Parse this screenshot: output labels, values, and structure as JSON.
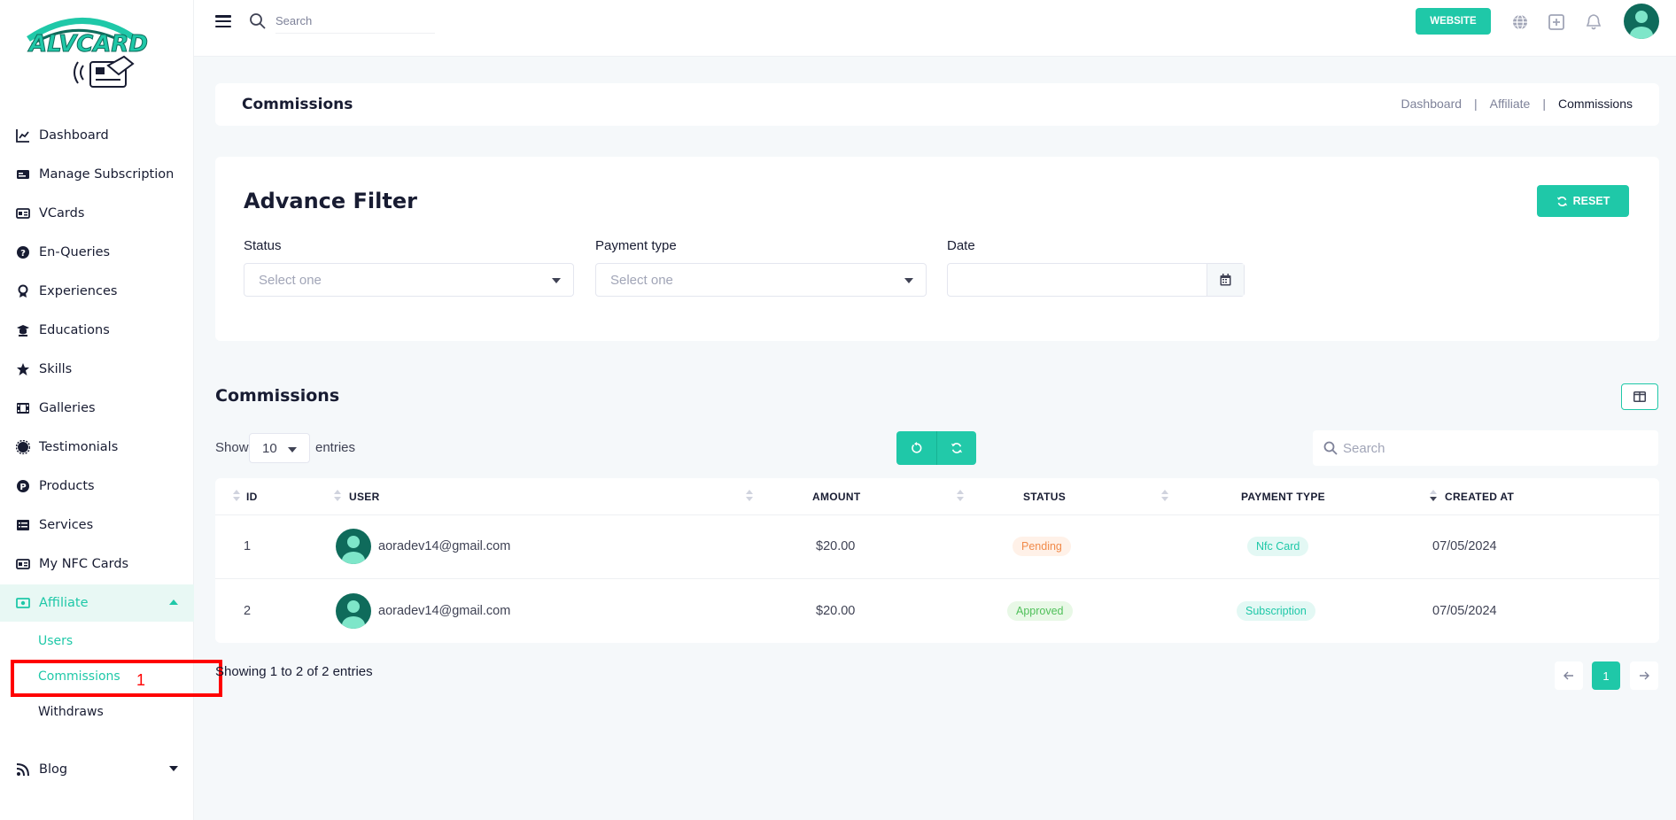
{
  "brand": {
    "logo_text": "ALVCARD",
    "accent": "#1fc8a8"
  },
  "sidebar": {
    "items": [
      {
        "label": "Dashboard",
        "icon": "chart-line-icon"
      },
      {
        "label": "Manage Subscription",
        "icon": "subscription-card-icon"
      },
      {
        "label": "VCards",
        "icon": "vcard-icon"
      },
      {
        "label": "En-Queries",
        "icon": "question-circle-icon"
      },
      {
        "label": "Experiences",
        "icon": "award-icon"
      },
      {
        "label": "Educations",
        "icon": "graduation-cap-icon"
      },
      {
        "label": "Skills",
        "icon": "star-icon"
      },
      {
        "label": "Galleries",
        "icon": "film-icon"
      },
      {
        "label": "Testimonials",
        "icon": "certificate-icon"
      },
      {
        "label": "Products",
        "icon": "product-p-icon"
      },
      {
        "label": "Services",
        "icon": "list-icon"
      },
      {
        "label": "My NFC Cards",
        "icon": "nfc-card-icon"
      },
      {
        "label": "Affiliate",
        "icon": "money-bill-icon"
      },
      {
        "label": "Blog",
        "icon": "blog-rss-icon"
      }
    ],
    "affiliate_sub": [
      "Users",
      "Commissions",
      "Withdraws"
    ]
  },
  "annotation": {
    "number": "1"
  },
  "topbar": {
    "search_placeholder": "Search",
    "website_label": "WEBSITE",
    "icons": [
      "globe-icon",
      "plus-square-icon",
      "bell-icon"
    ]
  },
  "page": {
    "title": "Commissions",
    "breadcrumb": {
      "first": "Dashboard",
      "second": "Affiliate",
      "current": "Commissions",
      "separator": "|"
    }
  },
  "filter": {
    "title": "Advance Filter",
    "reset_label": "RESET",
    "status_label": "Status",
    "status_placeholder": "Select one",
    "payment_label": "Payment type",
    "payment_placeholder": "Select one",
    "date_label": "Date"
  },
  "table": {
    "section_title": "Commissions",
    "show_label": "Show",
    "entries_label": "entries",
    "page_length": "10",
    "search_placeholder": "Search",
    "headers": {
      "id": "ID",
      "user": "USER",
      "amount": "AMOUNT",
      "status": "STATUS",
      "payment_type": "PAYMENT TYPE",
      "created_at": "CREATED AT"
    },
    "rows": [
      {
        "id": "1",
        "user": "aoradev14@gmail.com",
        "amount": "$20.00",
        "status": "Pending",
        "payment_type": "Nfc Card",
        "created_at": "07/05/2024"
      },
      {
        "id": "2",
        "user": "aoradev14@gmail.com",
        "amount": "$20.00",
        "status": "Approved",
        "payment_type": "Subscription",
        "created_at": "07/05/2024"
      }
    ],
    "footer_info": "Showing 1 to 2 of 2 entries",
    "current_page": "1"
  }
}
